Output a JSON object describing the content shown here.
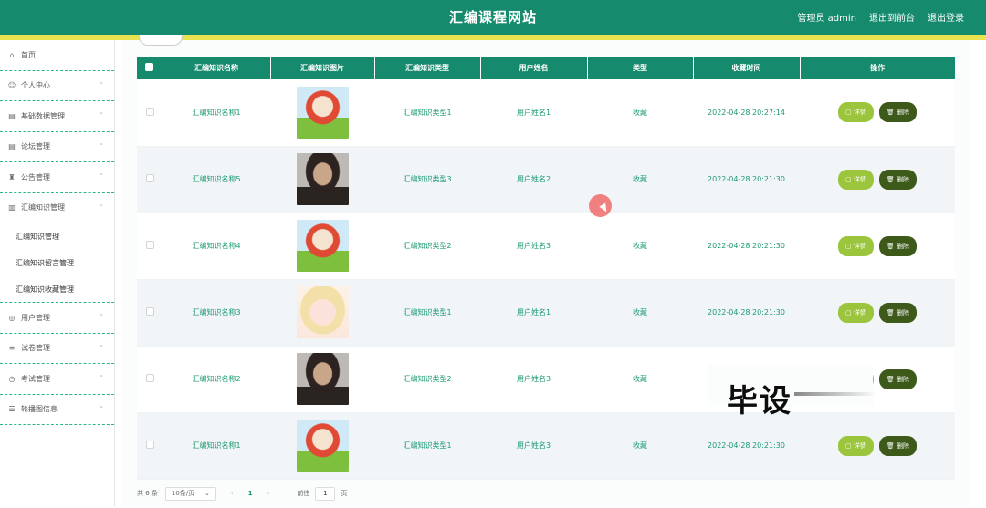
{
  "header": {
    "title": "汇编课程网站",
    "admin_label": "管理员 admin",
    "back_label": "退出到前台",
    "logout_label": "退出登录"
  },
  "sidebar": {
    "items": [
      {
        "label": "首页",
        "icon": "home-icon"
      },
      {
        "label": "个人中心",
        "icon": "user-icon"
      },
      {
        "label": "基础数据管理",
        "icon": "clipboard-icon"
      },
      {
        "label": "论坛管理",
        "icon": "clipboard-icon"
      },
      {
        "label": "公告管理",
        "icon": "trophy-icon"
      },
      {
        "label": "汇编知识管理",
        "icon": "building-icon"
      }
    ],
    "sub_items": [
      "汇编知识管理",
      "汇编知识留言管理",
      "汇编知识收藏管理"
    ],
    "items_after": [
      {
        "label": "用户管理",
        "icon": "globe-icon"
      },
      {
        "label": "试卷管理",
        "icon": "list-icon"
      },
      {
        "label": "考试管理",
        "icon": "clock-icon"
      },
      {
        "label": "轮播图信息",
        "icon": "sliders-icon"
      }
    ]
  },
  "table": {
    "headers": [
      "汇编知识名称",
      "汇编知识图片",
      "汇编知识类型",
      "用户姓名",
      "类型",
      "收藏时间",
      "操作"
    ],
    "rows": [
      {
        "name": "汇编知识名称1",
        "img": "cartoon-fox",
        "type": "汇编知识类型1",
        "user": "用户姓名1",
        "kind": "收藏",
        "time": "2022-04-28 20:27:14"
      },
      {
        "name": "汇编知识名称5",
        "img": "man-portrait",
        "type": "汇编知识类型3",
        "user": "用户姓名2",
        "kind": "收藏",
        "time": "2022-04-28 20:21:30"
      },
      {
        "name": "汇编知识名称4",
        "img": "cartoon-fox",
        "type": "汇编知识类型2",
        "user": "用户姓名3",
        "kind": "收藏",
        "time": "2022-04-28 20:21:30"
      },
      {
        "name": "汇编知识名称3",
        "img": "anime-girl",
        "type": "汇编知识类型1",
        "user": "用户姓名1",
        "kind": "收藏",
        "time": "2022-04-28 20:21:30"
      },
      {
        "name": "汇编知识名称2",
        "img": "man-portrait",
        "type": "汇编知识类型2",
        "user": "用户姓名3",
        "kind": "收藏",
        "time": "2022-04-28 20:21:30"
      },
      {
        "name": "汇编知识名称1",
        "img": "cartoon-fox",
        "type": "汇编知识类型1",
        "user": "用户姓名3",
        "kind": "收藏",
        "time": "2022-04-28 20:21:30"
      }
    ],
    "detail_label": "详情",
    "delete_label": "删除"
  },
  "pager": {
    "total": "共 6 条",
    "page_size": "10条/页",
    "current_page": "1",
    "goto_label": "前往",
    "goto_value": "1",
    "page_suffix": "页"
  },
  "watermark": "毕设",
  "colors": {
    "primary": "#168a6c",
    "accent_line": "#e8e14f",
    "detail_btn": "#9bc53d",
    "delete_btn": "#3d5a1b"
  }
}
